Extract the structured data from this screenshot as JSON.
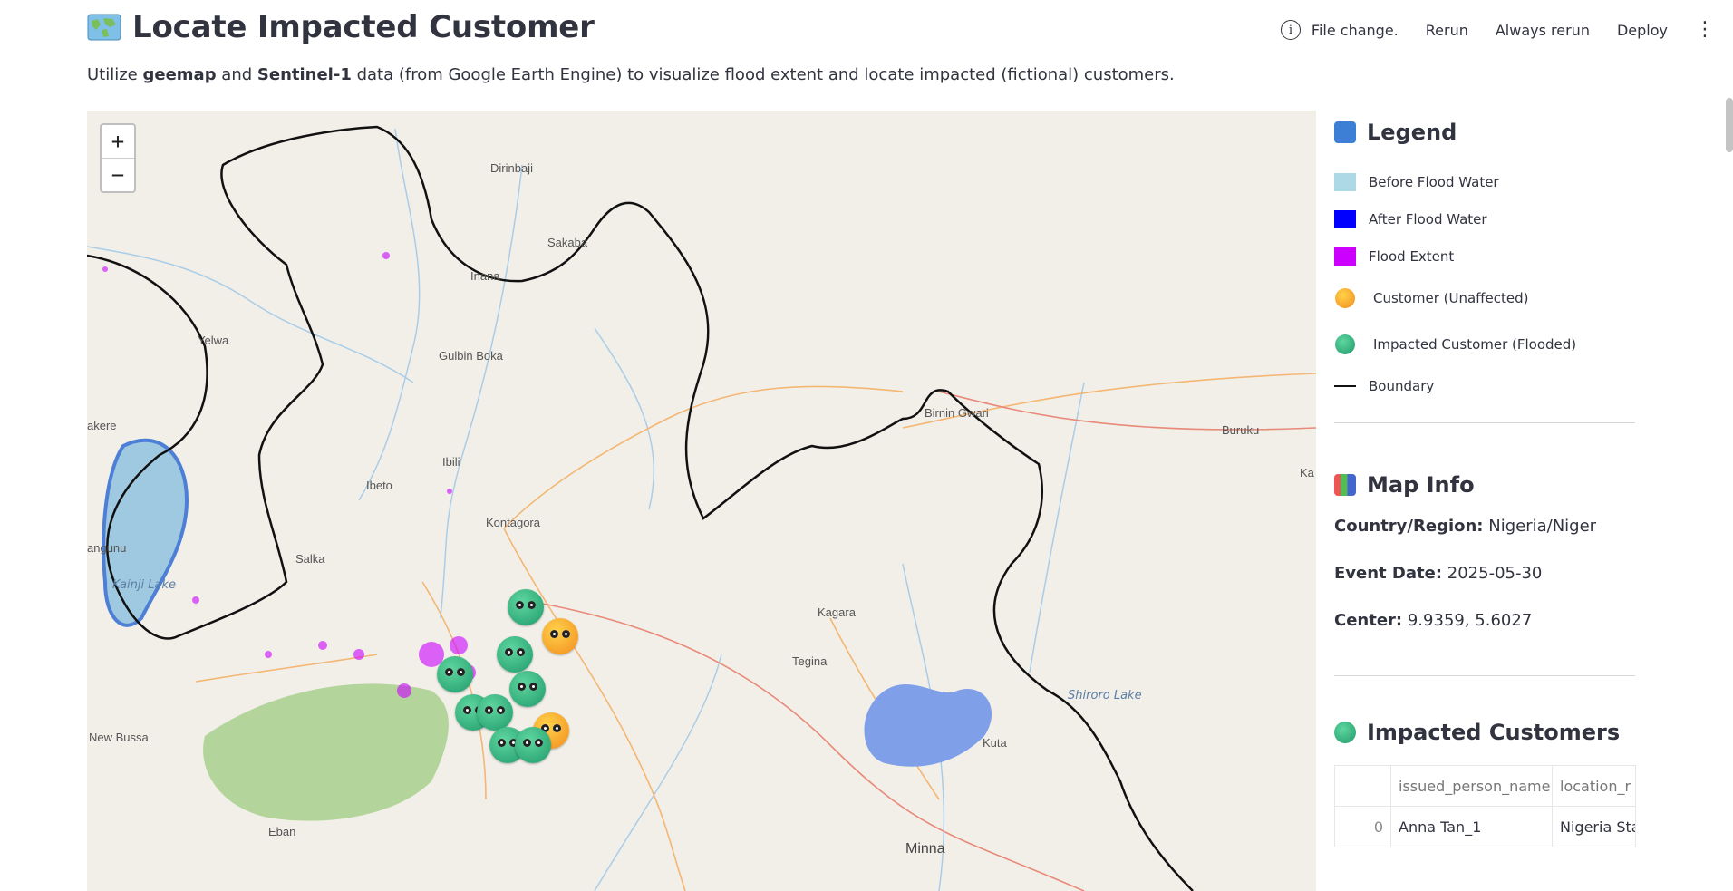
{
  "header": {
    "title": "Locate Impacted Customer",
    "subtitle_pre": "Utilize ",
    "subtitle_b1": "geemap",
    "subtitle_mid": " and ",
    "subtitle_b2": "Sentinel-1",
    "subtitle_post": " data (from Google Earth Engine) to visualize flood extent and locate impacted (fictional) customers."
  },
  "toolbar": {
    "status": "File change.",
    "rerun": "Rerun",
    "always_rerun": "Always rerun",
    "deploy": "Deploy",
    "menu_icon": "kebab-menu-icon"
  },
  "map": {
    "zoom_in": "+",
    "zoom_out": "−",
    "places": [
      "Dirinbaji",
      "Sakaba",
      "Inana",
      "Yelwa",
      "Gulbin Boka",
      "akere",
      "Ibili",
      "Ibeto",
      "Kontagora",
      "angunu",
      "Salka",
      "Kainji Lake",
      "Kagara",
      "Tegina",
      "Birnin Gwari",
      "Buruku",
      "Ka",
      "New Bussa",
      "Eban",
      "Minna",
      "Kuta",
      "Shiroro Lake"
    ],
    "customers_impacted_icon": "flooded-customer-icon",
    "customers_unaffected_icon": "unaffected-customer-icon"
  },
  "legend": {
    "heading": "Legend",
    "items": [
      {
        "label": "Before Flood Water",
        "color": "#add8e6"
      },
      {
        "label": "After Flood Water",
        "color": "#0000ff"
      },
      {
        "label": "Flood Extent",
        "color": "#cc00ff"
      },
      {
        "label": "Customer (Unaffected)"
      },
      {
        "label": "Impacted Customer (Flooded)"
      },
      {
        "label": "Boundary",
        "color": "#111111"
      }
    ]
  },
  "map_info": {
    "heading": "Map Info",
    "country_label": "Country/Region:",
    "country_value": "Nigeria/Niger",
    "date_label": "Event Date:",
    "date_value": "2025-05-30",
    "center_label": "Center:",
    "center_value": "9.9359, 5.6027"
  },
  "impacted": {
    "heading": "Impacted Customers",
    "columns": [
      "",
      "issued_person_name",
      "location_r"
    ],
    "rows": [
      [
        "0",
        "Anna Tan_1",
        "Nigeria Sta"
      ]
    ]
  }
}
